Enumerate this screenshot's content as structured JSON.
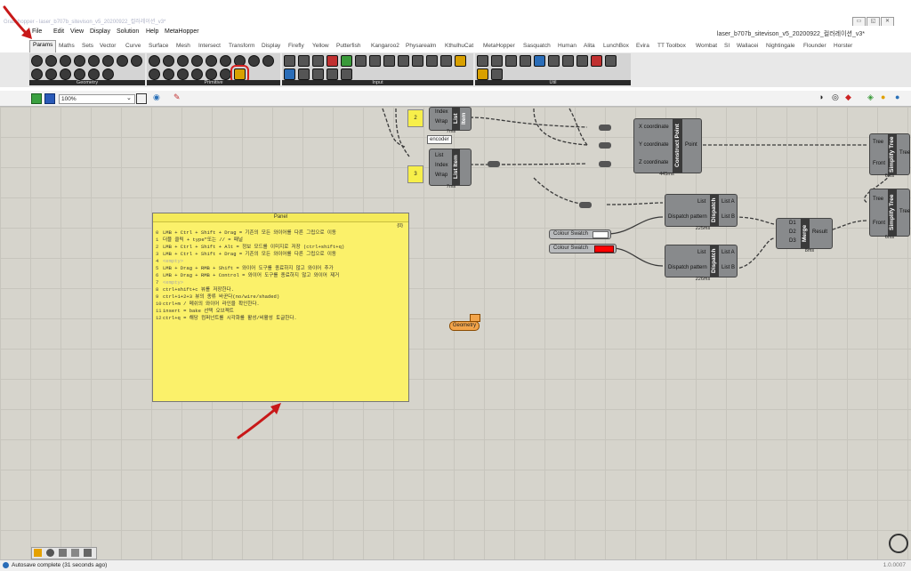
{
  "window": {
    "title": "Grasshopper - laser_b707b_sitevison_v5_20200922_컬러레이션_v3*",
    "doc_title": "laser_b707b_sitevison_v5_20200922_컬러레이션_v3*"
  },
  "menu": [
    "File",
    "Edit",
    "View",
    "Display",
    "Solution",
    "Help",
    "MetaHopper"
  ],
  "tabs": [
    "Params",
    "Maths",
    "Sets",
    "Vector",
    "Curve",
    "Surface",
    "Mesh",
    "Intersect",
    "Transform",
    "Display",
    "Firefly",
    "Yellow",
    "Putterfish",
    "Kangaroo2",
    "Physarealm",
    "KthulhuCat",
    "MetaHopper",
    "Sasquatch",
    "Human",
    "Alita",
    "LunchBox",
    "Evira",
    "TT Toolbox",
    "Wombat",
    "SI",
    "Wallacei",
    "Nightingale",
    "Flounder",
    "Horster"
  ],
  "ribbon_groups": [
    "Geometry",
    "Primitive",
    "Input",
    "Util"
  ],
  "toolbar": {
    "zoom": "100%"
  },
  "panel": {
    "title": "Panel",
    "path": "{0}",
    "lines": [
      {
        "i": "0",
        "t": "LMB + Ctrl + Shift + Drag = 기존의 모든 와이어를 다른 그립으로 이동"
      },
      {
        "i": "1",
        "t": "더블 클릭 + type\"또는 // = 패널"
      },
      {
        "i": "2",
        "t": "LMB + Ctrl + Shift + Alt = 정보 모드를 이미지로 저장 (ctrl+shift+q)"
      },
      {
        "i": "3",
        "t": "LMB + Ctrl + Shift + Drag = 기존의 모든 와이어를 다른 그립으로 이동"
      },
      {
        "i": "4",
        "t": "<empty>"
      },
      {
        "i": "5",
        "t": "LMB + Drag + RMB + Shift = 와이어 도구를 종료하지 않고 와이어 추가"
      },
      {
        "i": "6",
        "t": "LMB + Drag + RMB + Control = 와이어 도구를 종료하지 않고 와이어 제거"
      },
      {
        "i": "7",
        "t": "<empty>"
      },
      {
        "i": "8",
        "t": "ctrl+shift+c 뷰를 저장한다."
      },
      {
        "i": "9",
        "t": "ctrl+1+2+3 뷰의 종류 바꾼다(no/wire/shaded)"
      },
      {
        "i": "10",
        "t": "ctrl+m / 메쉬의 와이어 라인을 확인한다."
      },
      {
        "i": "11",
        "t": "insert  = bake 선택 오브젝트"
      },
      {
        "i": "12",
        "t": "ctrl+q = 해당 컴퍼넌트를 시각화를 활성/비활성 토글한다."
      }
    ]
  },
  "components": {
    "list_item_1": {
      "name": "List Item",
      "inputs": [
        "Index",
        "Wrap"
      ],
      "timing": "7ms",
      "slider": "2"
    },
    "list_item_2": {
      "name": "List Item",
      "inputs": [
        "List",
        "Index",
        "Wrap"
      ],
      "timing": "7ms",
      "slider": "3",
      "tooltip": "encoder"
    },
    "construct_point": {
      "name": "Construct Point",
      "inputs": [
        "X coordinate",
        "Y coordinate",
        "Z coordinate"
      ],
      "output": "Point",
      "timing": "445ms"
    },
    "simplify_1": {
      "name": "Simplify Tree",
      "inputs": [
        "Tree",
        "Front"
      ],
      "output": "Tree",
      "timing": "6ms"
    },
    "simplify_2": {
      "name": "Simplify Tree",
      "inputs": [
        "Tree",
        "Front"
      ],
      "output": "Tree",
      "timing": "6ms"
    },
    "dispatch_1": {
      "name": "Dispatch",
      "inputs": [
        "List",
        "Dispatch pattern"
      ],
      "outputs": [
        "List A",
        "List B"
      ],
      "timing": "225ms"
    },
    "dispatch_2": {
      "name": "Dispatch",
      "inputs": [
        "List",
        "Dispatch pattern"
      ],
      "outputs": [
        "List A",
        "List B"
      ],
      "timing": "226ms"
    },
    "merge": {
      "name": "Merge",
      "inputs": [
        "D1",
        "D2",
        "D3"
      ],
      "output": "Result",
      "timing": "8ms"
    },
    "swatch_1": {
      "label": "Colour Swatch",
      "color": "#ffffff"
    },
    "swatch_2": {
      "label": "Colour Swatch",
      "color": "#ff0000"
    },
    "geometry": {
      "label": "Geometry"
    }
  },
  "status": {
    "message": "Autosave complete (31 seconds ago)",
    "version": "1.0.0007"
  }
}
